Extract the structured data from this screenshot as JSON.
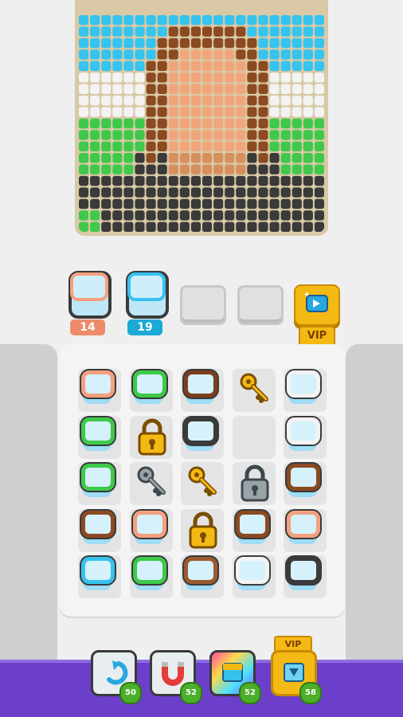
{
  "palette": {
    "sky": "#35c3ef",
    "white": "#f3f3f3",
    "green": "#3ec94a",
    "hair": "#8b4a21",
    "skin": "#f2a57a",
    "dark": "#3a3a3a",
    "tan": "#d88f5e"
  },
  "holder": {
    "slots": [
      {
        "color": "#f4a07e",
        "count": "14",
        "count_color": "#ef8a6a"
      },
      {
        "color": "#37c2ee",
        "count": "19",
        "count_color": "#1ba9d6"
      }
    ],
    "vip_label": "VIP"
  },
  "grid": {
    "cells": [
      [
        "#f4a07e",
        "#3ec94a",
        "#7a3f1c",
        "key-gold",
        "#f3f3f3"
      ],
      [
        "#3ec94a",
        "lock-gold",
        "#3a3a3a",
        "",
        "#f3f3f3"
      ],
      [
        "#3ec94a",
        "key-gray",
        "key-gold",
        "lock-gray",
        "#8b4a21"
      ],
      [
        "#8b4a21",
        "#f4a07e",
        "lock-gold",
        "#8b4a21",
        "#f4a07e"
      ],
      [
        "#37c2ee",
        "#3ec94a",
        "#9c5a30",
        "#f3f3f3",
        "#3a3a3a"
      ]
    ]
  },
  "powerups": [
    {
      "icon": "undo-icon",
      "price": "50"
    },
    {
      "icon": "magnet-icon",
      "price": "52"
    },
    {
      "icon": "rainbow-box-icon",
      "price": "52"
    },
    {
      "icon": "vip-box-icon",
      "price": "58",
      "badge": "VIP"
    }
  ]
}
